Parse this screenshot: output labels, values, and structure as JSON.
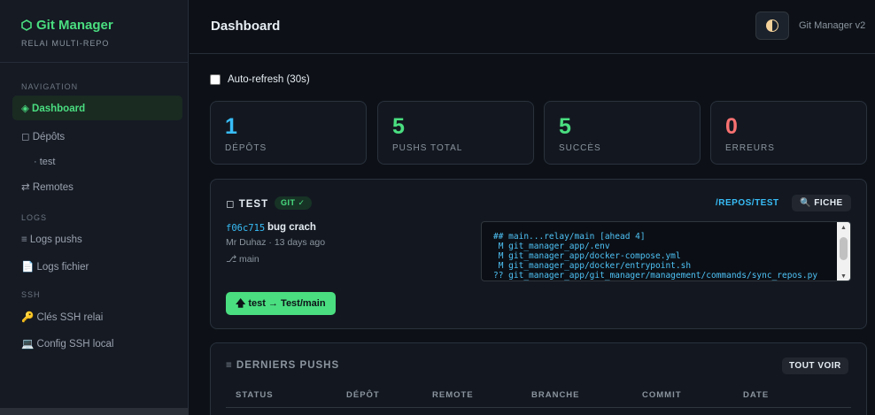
{
  "brand": {
    "title": "Git Manager",
    "subtitle": "RELAI MULTI-REPO",
    "icon": "hexagon-icon"
  },
  "sidebar": {
    "sections": {
      "navigation": "NAVIGATION",
      "logs": "LOGS",
      "ssh": "SSH"
    },
    "items": {
      "dashboard": "◈ Dashboard",
      "depots": "◻ Dépôts",
      "test": "· test",
      "remotes": "⇄ Remotes",
      "logs_push": "≡ Logs pushs",
      "logs_file": "📄 Logs fichier",
      "ssh_keys": "🔑 Clés SSH relai",
      "ssh_config": "💻 Config SSH local"
    }
  },
  "header": {
    "title": "Dashboard",
    "version": "Git Manager v2"
  },
  "autorefresh": {
    "label": "Auto-refresh (30s)",
    "checked": false
  },
  "stats": [
    {
      "value": "1",
      "label": "DÉPÔTS",
      "color": "#38bdf8"
    },
    {
      "value": "5",
      "label": "PUSHS TOTAL",
      "color": "#4ade80"
    },
    {
      "value": "5",
      "label": "SUCCÈS",
      "color": "#4ade80"
    },
    {
      "value": "0",
      "label": "ERREURS",
      "color": "#f87171"
    }
  ],
  "repo": {
    "name": "◻ TEST",
    "badge": "GIT ✓",
    "path": "/REPOS/TEST",
    "fiche_label": "🔍 FICHE",
    "commit_hash": "f06c715",
    "commit_message": "bug crach",
    "commit_meta": "Mr Duhaz · 13 days ago",
    "branch": "⎇ main",
    "push_label": "🡅 test → Test/main",
    "status_lines": [
      "## main...relay/main [ahead 4]",
      " M git_manager_app/.env",
      " M git_manager_app/docker-compose.yml",
      " M git_manager_app/docker/entrypoint.sh",
      "?? git_manager_app/git_manager/management/commands/sync_repos.py"
    ]
  },
  "pushes": {
    "title": "≡ DERNIERS PUSHS",
    "all_label": "TOUT VOIR",
    "columns": [
      "STATUS",
      "DÉPÔT",
      "REMOTE",
      "BRANCHE",
      "COMMIT",
      "DATE"
    ]
  }
}
